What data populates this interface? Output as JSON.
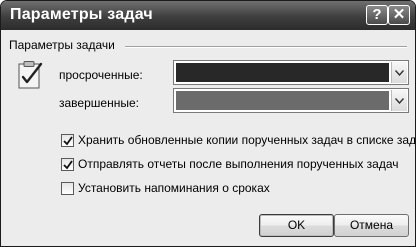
{
  "window": {
    "title": "Параметры задач",
    "help_label": "?",
    "close_label": "✕"
  },
  "group": {
    "label": "Параметры задачи"
  },
  "icon": "task-clipboard-icon",
  "fields": {
    "overdue": {
      "label": "просроченные:",
      "color": "#282828"
    },
    "completed": {
      "label": "завершенные:",
      "color": "#6b6b6b"
    }
  },
  "options": [
    {
      "label": "Хранить обновленные копии порученных задач в списке задач",
      "checked": true
    },
    {
      "label": "Отправлять отчеты после выполнения порученных задач",
      "checked": true
    },
    {
      "label": "Установить напоминания о сроках",
      "checked": false
    }
  ],
  "buttons": {
    "ok": "OK",
    "cancel": "Отмена"
  }
}
